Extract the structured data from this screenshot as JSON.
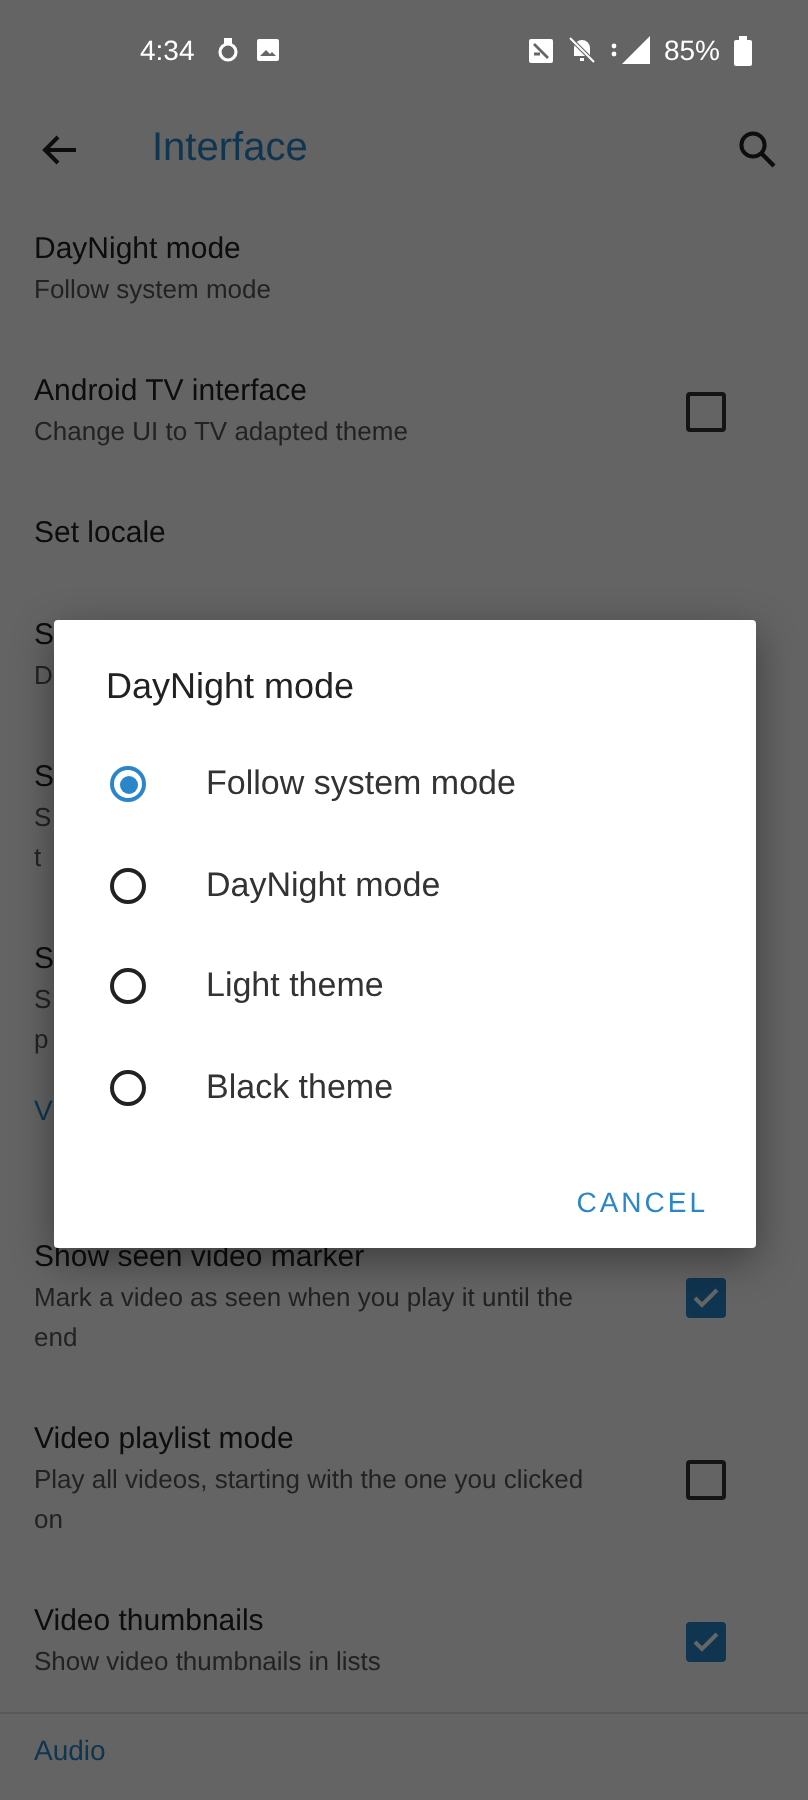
{
  "status_bar": {
    "time": "4:34",
    "battery": "85%"
  },
  "toolbar": {
    "title": "Interface"
  },
  "preferences": [
    {
      "kind": "item",
      "title": "DayNight mode",
      "summary": "Follow system mode"
    },
    {
      "kind": "checkbox",
      "title": "Android TV interface",
      "summary": "Change UI to TV adapted theme",
      "checked": false
    },
    {
      "kind": "item",
      "title": "Set locale"
    },
    {
      "kind": "item",
      "title": "S",
      "summary": "D"
    },
    {
      "kind": "item",
      "title": "S",
      "summary": "S\nt"
    },
    {
      "kind": "item",
      "title": "S",
      "summary": "S\np"
    },
    {
      "kind": "category",
      "title": "V"
    },
    {
      "kind": "checkbox",
      "title": "Show seen video marker",
      "summary": "Mark a video as seen when you play it until the end",
      "checked": true
    },
    {
      "kind": "checkbox",
      "title": "Video playlist mode",
      "summary": "Play all videos, starting with the one you clicked on",
      "checked": false
    },
    {
      "kind": "checkbox",
      "title": "Video thumbnails",
      "summary": "Show video thumbnails in lists",
      "checked": true
    },
    {
      "kind": "category",
      "title": "Audio"
    }
  ],
  "dialog": {
    "title": "DayNight mode",
    "options": [
      {
        "label": "Follow system mode",
        "selected": true
      },
      {
        "label": "DayNight mode",
        "selected": false
      },
      {
        "label": "Light theme",
        "selected": false
      },
      {
        "label": "Black theme",
        "selected": false
      }
    ],
    "button": "CANCEL"
  }
}
